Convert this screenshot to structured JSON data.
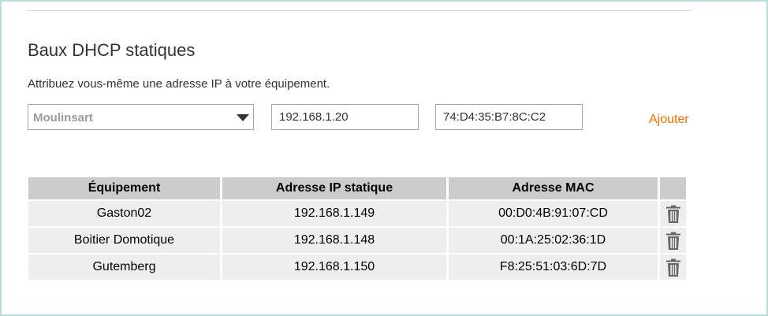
{
  "section": {
    "title": "Baux DHCP statiques",
    "description": "Attribuez vous-même une adresse IP à votre équipement."
  },
  "form": {
    "device_select": {
      "selected": "Moulinsart"
    },
    "ip_input": {
      "value": "192.168.1.20"
    },
    "mac_input": {
      "value": "74:D4:35:B7:8C:C2"
    },
    "add_label": "Ajouter"
  },
  "table": {
    "headers": [
      "Équipement",
      "Adresse IP statique",
      "Adresse MAC"
    ],
    "rows": [
      {
        "device": "Gaston02",
        "ip": "192.168.1.149",
        "mac": "00:D0:4B:91:07:CD",
        "action_icon": "trash-icon"
      },
      {
        "device": "Boitier Domotique",
        "ip": "192.168.1.148",
        "mac": "00:1A:25:02:36:1D",
        "action_icon": "trash-icon"
      },
      {
        "device": "Gutemberg",
        "ip": "192.168.1.150",
        "mac": "F8:25:51:03:6D:7D",
        "action_icon": "trash-icon"
      }
    ]
  },
  "colors": {
    "accent": "#f16e00",
    "frame_border": "#b9ded9",
    "header_bg": "#cccccc",
    "row_bg": "#eeeeee",
    "icon": "#666666"
  }
}
